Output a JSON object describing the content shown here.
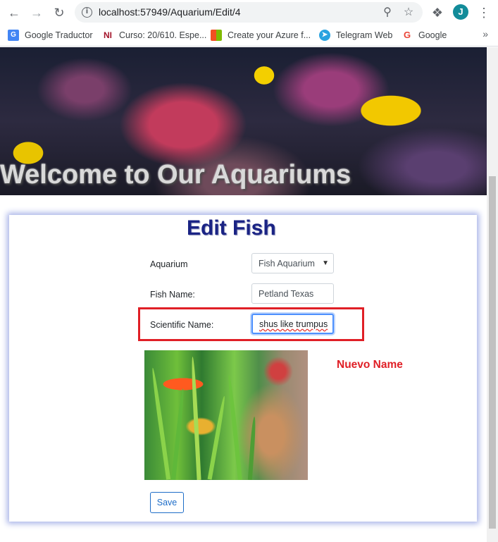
{
  "browser": {
    "url": "localhost:57949/Aquarium/Edit/4",
    "avatar_letter": "J",
    "bookmarks": [
      {
        "label": "Google Traductor",
        "icon": "google-translate-icon",
        "color": "#4285f4"
      },
      {
        "label": "Curso: 20/610. Espe...",
        "icon": "ni-icon",
        "color": "#a3142a"
      },
      {
        "label": "Create your Azure f...",
        "icon": "microsoft-icon",
        "color": "#f25022"
      },
      {
        "label": "Telegram Web",
        "icon": "telegram-icon",
        "color": "#2aa3e0"
      },
      {
        "label": "Google",
        "icon": "google-icon",
        "color": "#ea4335"
      }
    ],
    "more": "»"
  },
  "hero": {
    "title": "Welcome to Our Aquariums"
  },
  "form": {
    "title": "Edit Fish",
    "aquarium_label": "Aquarium",
    "aquarium_value": "Fish Aquarium",
    "fish_name_label": "Fish Name:",
    "fish_name_value": "Petland Texas",
    "scientific_name_label": "Scientific Name:",
    "scientific_name_value": "shus like trumpus",
    "annotation": "Nuevo Name",
    "save_label": "Save"
  },
  "colors": {
    "title": "#1a2384",
    "highlight": "#e01f26",
    "save": "#1e6dc8"
  }
}
